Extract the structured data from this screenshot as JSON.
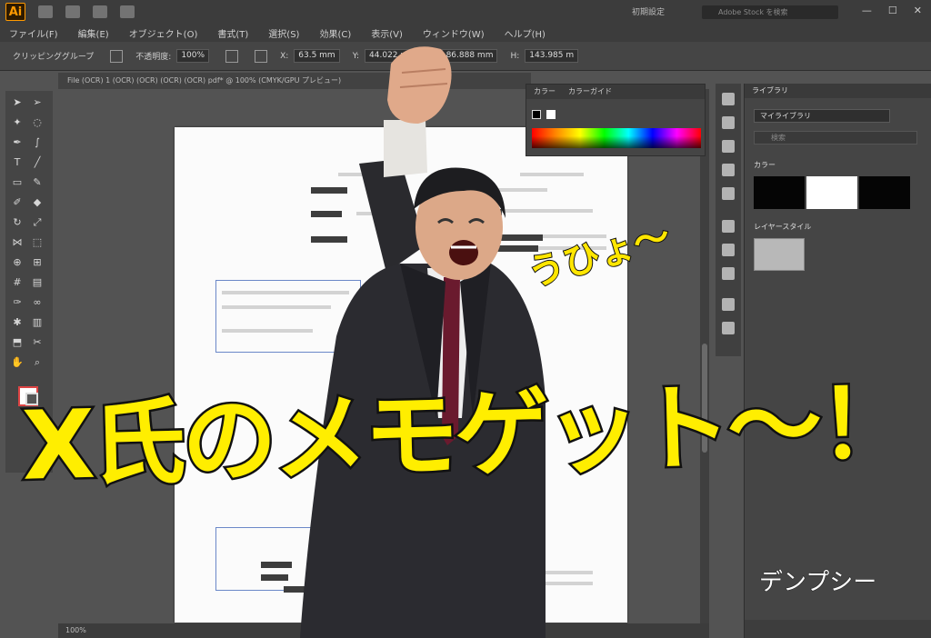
{
  "app": {
    "logo": "Ai",
    "workspace": "初期設定",
    "search_placeholder": "Adobe Stock を検索"
  },
  "menu": [
    "ファイル(F)",
    "編集(E)",
    "オブジェクト(O)",
    "書式(T)",
    "選択(S)",
    "効果(C)",
    "表示(V)",
    "ウィンドウ(W)",
    "ヘルプ(H)"
  ],
  "control_bar": {
    "selection": "クリッピンググループ",
    "opacity_label": "不透明度:",
    "opacity_value": "100%",
    "x_value": "63.5 mm",
    "y_value": "44.022 m",
    "w_value": "86.888 mm",
    "h_value": "143.985 m"
  },
  "document": {
    "tab_label": "File (OCR) 1 (OCR) (OCR) (OCR) (OCR) pdf* @ 100% (CMYK/GPU プレビュー)",
    "zoom": "100%"
  },
  "color_panel": {
    "tabs": [
      "カラー",
      "カラーガイド"
    ]
  },
  "libraries_panel": {
    "tab": "ライブラリ",
    "library_name": "マイライブラリ",
    "search_placeholder": "検索",
    "colors_heading": "カラー",
    "colors": [
      "#050505",
      "#ffffff",
      "#050505"
    ],
    "styles_heading": "レイヤースタイル"
  },
  "overlay": {
    "caption": "X氏のメモゲット〜！",
    "shout": "うひょ〜",
    "signature": "デンプシー"
  }
}
